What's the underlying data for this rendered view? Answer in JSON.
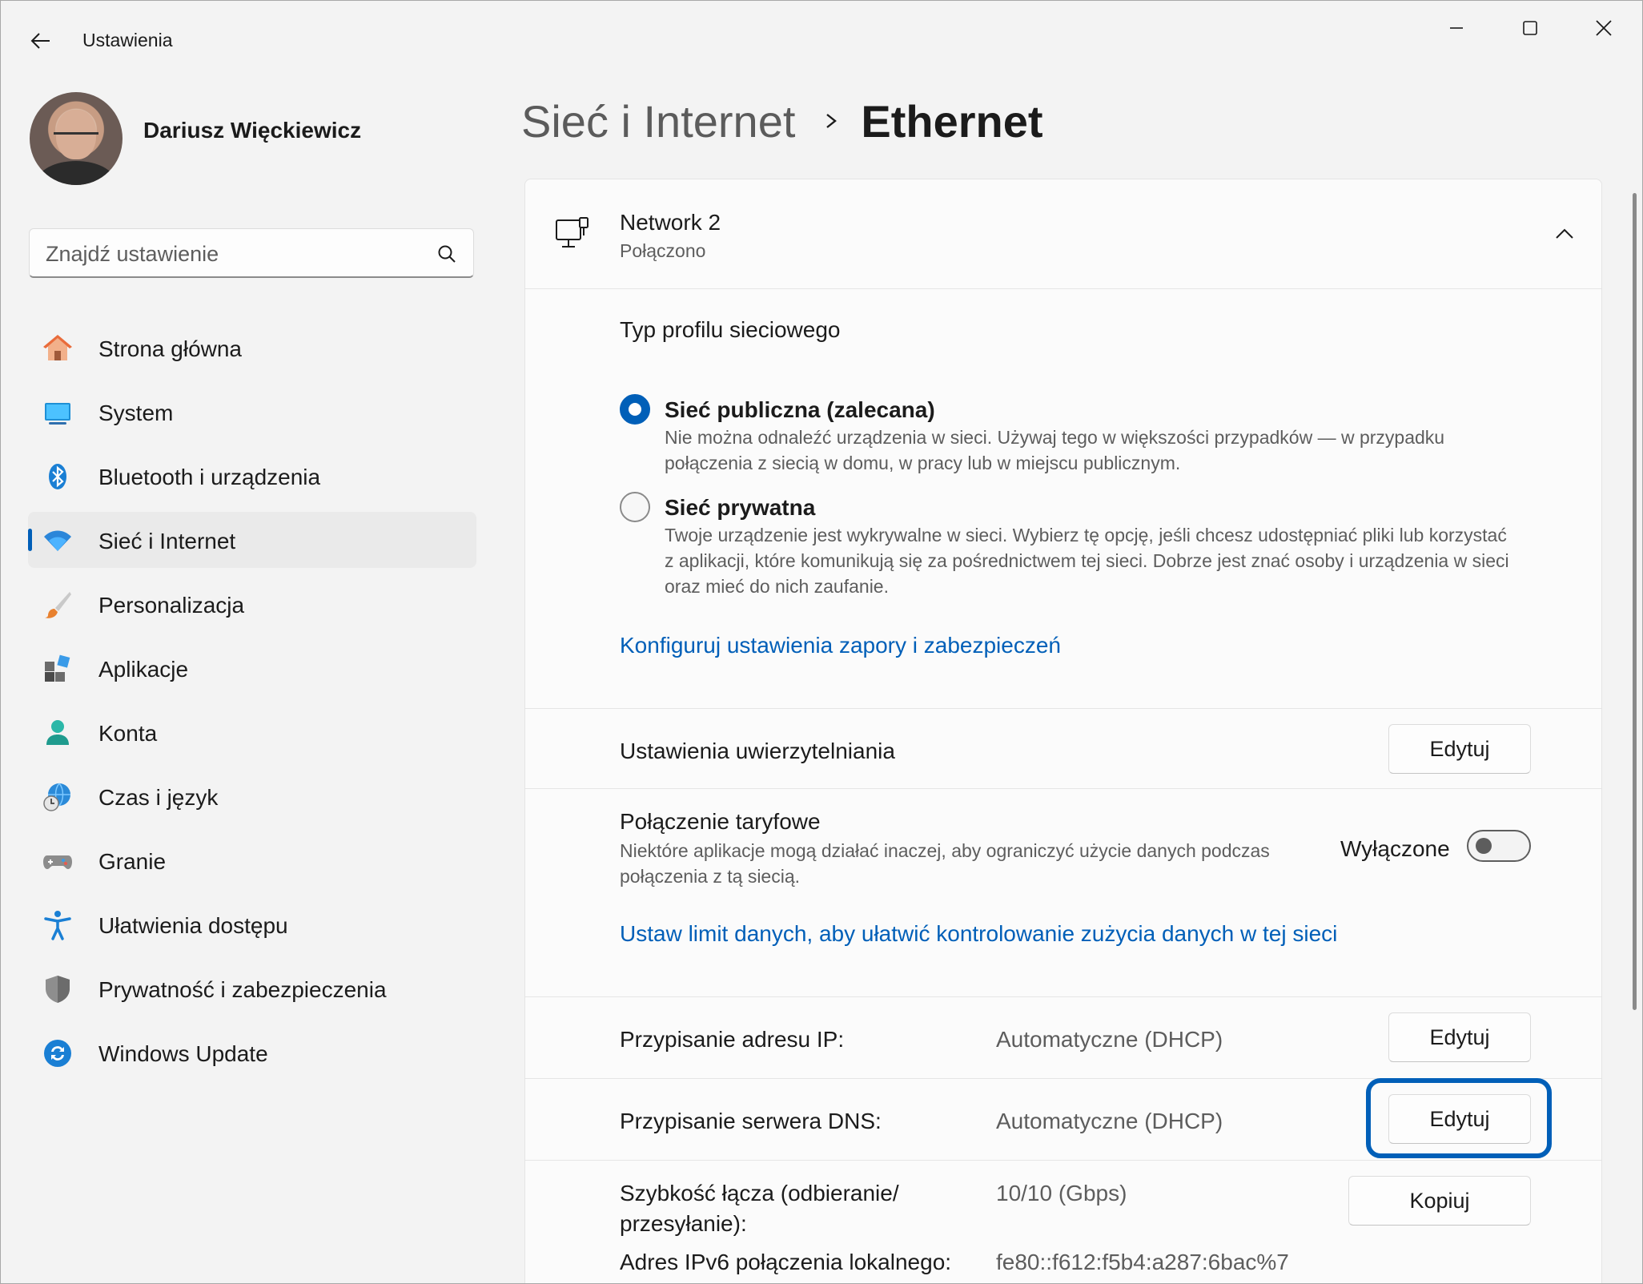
{
  "window": {
    "title": "Ustawienia",
    "controls": {
      "minimize": "minimize-icon",
      "maximize": "maximize-icon",
      "close": "close-icon"
    }
  },
  "profile": {
    "name": "Dariusz Więckiewicz"
  },
  "search": {
    "placeholder": "Znajdź ustawienie"
  },
  "sidebar": {
    "items": [
      {
        "label": "Strona główna",
        "icon": "home-icon",
        "active": false
      },
      {
        "label": "System",
        "icon": "system-icon",
        "active": false
      },
      {
        "label": "Bluetooth i urządzenia",
        "icon": "bluetooth-icon",
        "active": false
      },
      {
        "label": "Sieć i Internet",
        "icon": "wifi-icon",
        "active": true
      },
      {
        "label": "Personalizacja",
        "icon": "brush-icon",
        "active": false
      },
      {
        "label": "Aplikacje",
        "icon": "apps-icon",
        "active": false
      },
      {
        "label": "Konta",
        "icon": "account-icon",
        "active": false
      },
      {
        "label": "Czas i język",
        "icon": "globe-clock-icon",
        "active": false
      },
      {
        "label": "Granie",
        "icon": "gamepad-icon",
        "active": false
      },
      {
        "label": "Ułatwienia dostępu",
        "icon": "accessibility-icon",
        "active": false
      },
      {
        "label": "Prywatność i zabezpieczenia",
        "icon": "shield-icon",
        "active": false
      },
      {
        "label": "Windows Update",
        "icon": "update-icon",
        "active": false
      }
    ]
  },
  "breadcrumb": {
    "parent": "Sieć i Internet",
    "current": "Ethernet"
  },
  "network": {
    "name": "Network 2",
    "status": "Połączono",
    "profile_section_title": "Typ profilu sieciowego",
    "profile_options": [
      {
        "label": "Sieć publiczna (zalecana)",
        "selected": true,
        "description": "Nie można odnaleźć urządzenia w sieci. Używaj tego w większości przypadków — w przypadku połączenia z siecią w domu, w pracy lub w miejscu publicznym."
      },
      {
        "label": "Sieć prywatna",
        "selected": false,
        "description": "Twoje urządzenie jest wykrywalne w sieci. Wybierz tę opcję, jeśli chcesz udostępniać pliki lub korzystać z aplikacji, które komunikują się za pośrednictwem tej sieci. Dobrze jest znać osoby i urządzenia w sieci oraz mieć do nich zaufanie."
      }
    ],
    "firewall_link": "Konfiguruj ustawienia zapory i zabezpieczeń",
    "auth": {
      "label": "Ustawienia uwierzytelniania",
      "button": "Edytuj"
    },
    "metered": {
      "label": "Połączenie taryfowe",
      "description": "Niektóre aplikacje mogą działać inaczej, aby ograniczyć użycie danych podczas połączenia z tą siecią.",
      "state_label": "Wyłączone",
      "enabled": false
    },
    "data_limit_link": "Ustaw limit danych, aby ułatwić kontrolowanie zużycia danych w tej sieci",
    "ip": {
      "label": "Przypisanie adresu IP:",
      "value": "Automatyczne (DHCP)",
      "button": "Edytuj"
    },
    "dns": {
      "label": "Przypisanie serwera DNS:",
      "value": "Automatyczne (DHCP)",
      "button": "Edytuj"
    },
    "speed": {
      "label_line1": "Szybkość łącza (odbieranie/",
      "label_line2": "przesyłanie):",
      "value": "10/10 (Gbps)",
      "button": "Kopiuj"
    },
    "ipv6": {
      "label": "Adres IPv6 połączenia lokalnego:",
      "value": "fe80::f612:f5b4:a287:6bac%7"
    }
  },
  "colors": {
    "accent": "#005fb8",
    "link": "#005fb8",
    "secondary_text": "#5d5d5d"
  }
}
